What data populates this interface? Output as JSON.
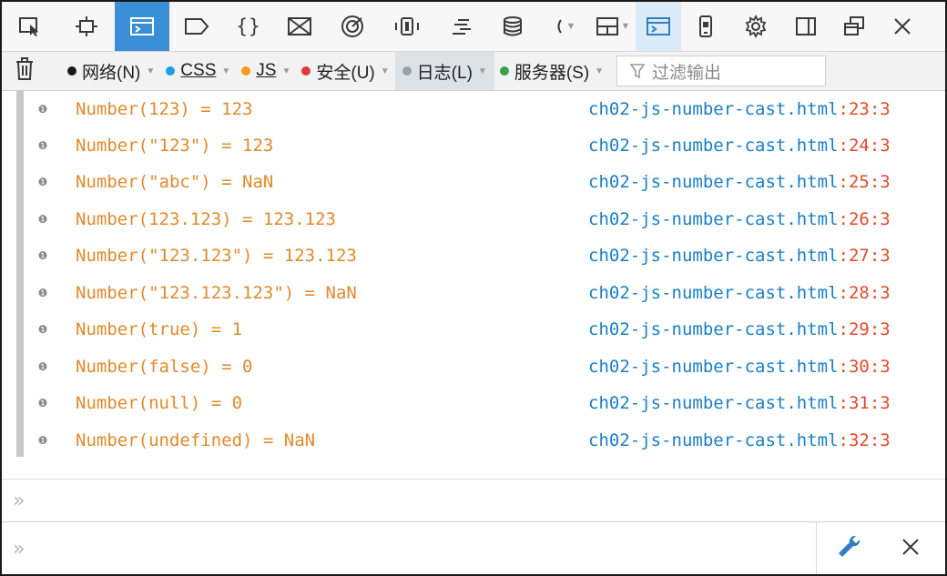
{
  "toolbar": {
    "tools": [
      {
        "icon": "pick-element-icon"
      },
      {
        "icon": "inspector-icon"
      },
      {
        "icon": "console-icon",
        "active": true
      },
      {
        "icon": "debugger-icon"
      },
      {
        "icon": "style-editor-icon",
        "text": "{}"
      },
      {
        "icon": "performance-icon"
      },
      {
        "icon": "memory-icon"
      },
      {
        "icon": "network-icon"
      },
      {
        "icon": "timeline-icon"
      },
      {
        "icon": "storage-icon"
      },
      {
        "icon": "more-tools-icon"
      },
      {
        "icon": "layout-icon"
      },
      {
        "icon": "split-console-icon"
      },
      {
        "icon": "responsive-design-icon"
      },
      {
        "icon": "settings-gear-icon"
      },
      {
        "icon": "dock-side-icon"
      },
      {
        "icon": "undock-window-icon"
      },
      {
        "icon": "close-icon"
      }
    ]
  },
  "filters": {
    "items": [
      {
        "label": "网络(N)",
        "color": "#1a1a1a"
      },
      {
        "label": "CSS",
        "color": "#1aa3e0"
      },
      {
        "label": "JS",
        "color": "#f39a1a"
      },
      {
        "label": "安全(U)",
        "color": "#e23a3a"
      },
      {
        "label": "日志(L)",
        "color": "#9aa0a6",
        "selected": true
      },
      {
        "label": "服务器(S)",
        "color": "#3aa04a"
      }
    ],
    "search_placeholder": "过滤输出"
  },
  "console": {
    "rows": [
      {
        "message": "Number(123) = 123",
        "file": "ch02-js-number-cast.html",
        "location": ":23:3"
      },
      {
        "message": "Number(\"123\") = 123",
        "file": "ch02-js-number-cast.html",
        "location": ":24:3"
      },
      {
        "message": "Number(\"abc\") = NaN",
        "file": "ch02-js-number-cast.html",
        "location": ":25:3"
      },
      {
        "message": "Number(123.123) = 123.123",
        "file": "ch02-js-number-cast.html",
        "location": ":26:3"
      },
      {
        "message": "Number(\"123.123\") = 123.123",
        "file": "ch02-js-number-cast.html",
        "location": ":27:3"
      },
      {
        "message": "Number(\"123.123.123\") = NaN",
        "file": "ch02-js-number-cast.html",
        "location": ":28:3"
      },
      {
        "message": "Number(true) = 1",
        "file": "ch02-js-number-cast.html",
        "location": ":29:3"
      },
      {
        "message": "Number(false) = 0",
        "file": "ch02-js-number-cast.html",
        "location": ":30:3"
      },
      {
        "message": "Number(null) = 0",
        "file": "ch02-js-number-cast.html",
        "location": ":31:3"
      },
      {
        "message": "Number(undefined) = NaN",
        "file": "ch02-js-number-cast.html",
        "location": ":32:3"
      }
    ]
  },
  "input": {
    "prompt_symbol": "»"
  },
  "colors": {
    "accent": "#3a8fd6",
    "message": "#e08a2c",
    "source_file": "#1a7fc4",
    "source_location": "#e24a2a"
  }
}
